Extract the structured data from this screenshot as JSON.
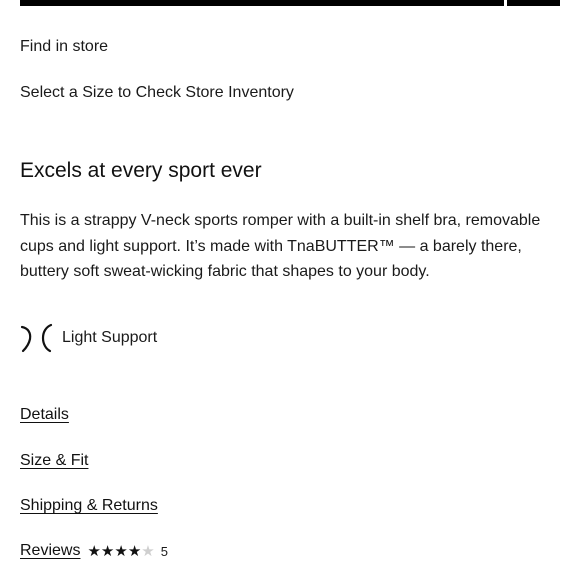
{
  "find_in_store": "Find in store",
  "size_prompt": "Select a Size to Check Store Inventory",
  "headline": "Excels at every sport ever",
  "description": "This is a strappy V-neck sports romper with a built-in shelf bra, removable cups and light support. It’s made with TnaBUTTER™ — a barely there, buttery soft sweat-wicking fabric that shapes to your body.",
  "support": {
    "icon": "light-support-icon",
    "label": "Light Support"
  },
  "accordion": {
    "details": "Details",
    "size_fit": "Size & Fit",
    "shipping_returns": "Shipping & Returns",
    "reviews": "Reviews"
  },
  "rating": {
    "stars_filled": 4,
    "stars_total": 5,
    "count": "5"
  },
  "colors": {
    "text": "#1a1a1a",
    "star_filled": "#111111",
    "star_empty": "#cfcfcf"
  }
}
